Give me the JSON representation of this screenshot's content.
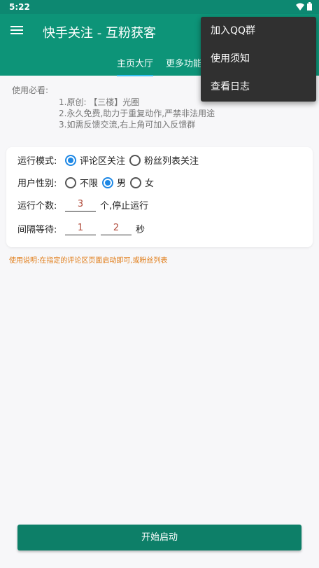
{
  "status_bar": {
    "time": "5:22",
    "icons": [
      "wifi-icon",
      "battery-icon"
    ]
  },
  "app": {
    "title": "快手关注 - 互粉获客",
    "accent_color": "#0d9478"
  },
  "tabs": [
    {
      "label": "主页大厅",
      "active": true
    },
    {
      "label": "更多功能",
      "active": false
    }
  ],
  "menu": {
    "items": [
      {
        "label": "加入QQ群"
      },
      {
        "label": "使用须知"
      },
      {
        "label": "查看日志"
      }
    ]
  },
  "notice": {
    "heading": "使用必看:",
    "lines": [
      "1.原创: 【三楼】光圈",
      "2.永久免费,助力于重复动作,严禁非法用途",
      "3.如需反馈交流,右上角可加入反馈群"
    ]
  },
  "settings": {
    "mode": {
      "label": "运行模式:",
      "options": [
        "评论区关注",
        "粉丝列表关注"
      ],
      "selected": 0
    },
    "gender": {
      "label": "用户性别:",
      "options": [
        "不限",
        "男",
        "女"
      ],
      "selected": 1
    },
    "count": {
      "label": "运行个数:",
      "value": "3",
      "suffix": "个,停止运行"
    },
    "interval": {
      "label": "间隔等待:",
      "min": "1",
      "max": "2",
      "suffix": "秒"
    }
  },
  "hint": "使用说明:在指定的评论区页面启动即可,或粉丝列表",
  "start_button": {
    "label": "开始启动"
  }
}
